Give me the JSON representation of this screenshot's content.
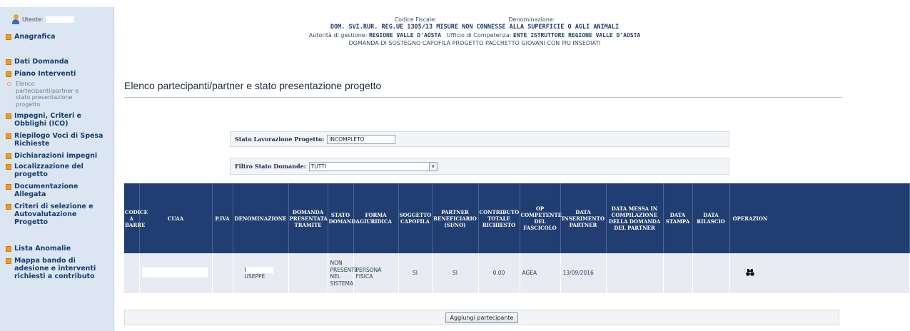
{
  "sidebar": {
    "user_label": "Utente:",
    "items": [
      {
        "label": "Anagrafica"
      },
      {
        "label": "Dati Domanda"
      },
      {
        "label": "Piano Interventi"
      },
      {
        "label": "Elenco partecipanti/partner e stato presentazione progetto",
        "sub": true
      },
      {
        "label": "Impegni, Criteri e Obblighi (ICO)"
      },
      {
        "label": "Riepilogo Voci di Spesa Richieste"
      },
      {
        "label": "Dichiarazioni impegni"
      },
      {
        "label": "Localizzazione del progetto"
      },
      {
        "label": "Documentazione Allegata"
      },
      {
        "label": "Criteri di selezione e Autovalutazione Progetto"
      },
      {
        "label": "Lista Anomalie"
      },
      {
        "label": "Mappa bando di adesione e interventi richiesti a contributo"
      }
    ]
  },
  "header": {
    "codice_fiscale_label": "Codice Fiscale:",
    "denominazione_label": "Denominazione:",
    "measure": "DOM. SVI.RUR. REG.UE 1305/13 MISURE NON CONNESSE ALLA SUPERFICIE O AGLI ANIMALI",
    "autorita_label": "Autorità di gestione:",
    "autorita_value": "REGIONE VALLE D'AOSTA",
    "ufficio_label": "Ufficio di Competenza:",
    "ufficio_value": "ENTE ISTRUTTORE REGIONE VALLE D'AOSTA",
    "domanda_type": "DOMANDA DI SOSTEGNO CAPOFILA PROGETTO PACCHETTO GIOVANI CON PIU INSEDIATI"
  },
  "page_title": "Elenco partecipanti/partner e stato presentazione progetto",
  "filters": {
    "stato_label": "Stato Lavorazione Progetto:",
    "stato_value": "INCOMPLETO",
    "filtro_label": "Filtro Stato Domande:",
    "filtro_value": "TUTTI"
  },
  "table": {
    "headers": [
      "CODICE A BARRE",
      "CUAA",
      "P.IVA",
      "DENOMINAZIONE",
      "DOMANDA PRESENTATA TRAMITE",
      "STATO DOMANDA",
      "FORMA GIURIDICA",
      "SOGGETTO CAPOFILA",
      "PARTNER BENEFICIARIO (SI/NO)",
      "CONTRIBUTO TOTALE RICHIESTO",
      "OP COMPETENTE DEL FASCICOLO",
      "DATA INSERIMENTO PARTNER",
      "DATA MESSA IN COMPILAZIONE DELLA DOMANDA DEL PARTNER",
      "DATA STAMPA",
      "DATA RILASCIO",
      "OPERAZION"
    ],
    "rows": [
      {
        "codice_a_barre": "",
        "cuaa": "",
        "piva": "",
        "denominazione_prefix": "I",
        "denominazione_suffix": "USEPPE",
        "domanda_presentata_tramite": "",
        "stato_domanda": "NON PRESENTE NEL SISTEMA",
        "forma_giuridica": "PERSONA FISICA",
        "soggetto_capofila": "SI",
        "partner_beneficiario": "SI",
        "contributo_totale": "0,00",
        "op_competente": "AGEA",
        "data_inserimento": "13/09/2016",
        "data_messa_compilazione": "",
        "data_stampa": "",
        "data_rilascio": "",
        "operazione_icon": "binoculars-icon"
      }
    ]
  },
  "add_button_label": "Aggiungi partecipante",
  "colors": {
    "sidebar_bg": "#dbe6f2",
    "header_bg": "#213e72",
    "bullet": "#f29a1d",
    "row_bg": "#e8ecf2"
  }
}
